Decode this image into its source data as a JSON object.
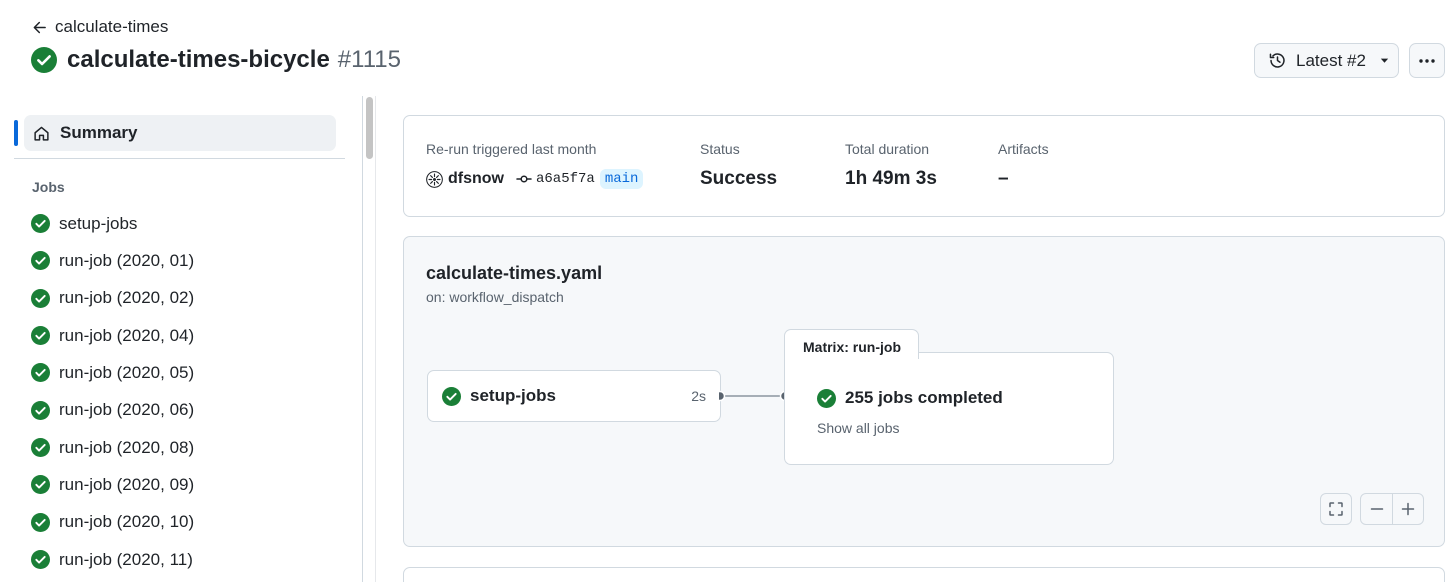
{
  "header": {
    "back_label": "calculate-times",
    "run_name": "calculate-times-bicycle",
    "run_number": "#1115",
    "attempt_label": "Latest #2"
  },
  "sidebar": {
    "summary_label": "Summary",
    "jobs_heading": "Jobs",
    "jobs": [
      {
        "label": "setup-jobs"
      },
      {
        "label": "run-job (2020, 01)"
      },
      {
        "label": "run-job (2020, 02)"
      },
      {
        "label": "run-job (2020, 04)"
      },
      {
        "label": "run-job (2020, 05)"
      },
      {
        "label": "run-job (2020, 06)"
      },
      {
        "label": "run-job (2020, 08)"
      },
      {
        "label": "run-job (2020, 09)"
      },
      {
        "label": "run-job (2020, 10)"
      },
      {
        "label": "run-job (2020, 11)"
      }
    ]
  },
  "summary": {
    "trigger_label": "Re-run triggered last month",
    "actor": "dfsnow",
    "commit_sha": "a6a5f7a",
    "branch": "main",
    "status_label": "Status",
    "status_value": "Success",
    "duration_label": "Total duration",
    "duration_value": "1h 49m 3s",
    "artifacts_label": "Artifacts",
    "artifacts_value": "–"
  },
  "workflow": {
    "file_name": "calculate-times.yaml",
    "trigger": "on: workflow_dispatch",
    "setup_node": {
      "name": "setup-jobs",
      "duration": "2s"
    },
    "matrix": {
      "tab_label": "Matrix: run-job",
      "completed_text": "255 jobs completed",
      "show_all_label": "Show all jobs"
    }
  },
  "colors": {
    "success": "#1a7f37",
    "accent": "#0969da",
    "border": "#d1d9e0",
    "muted_text": "#59636e"
  },
  "icons": {
    "status": "check-circle-fill-icon",
    "back": "arrow-left-icon",
    "history": "history-icon",
    "more": "kebab-horizontal-icon",
    "summary": "home-icon",
    "commit": "git-commit-icon"
  }
}
